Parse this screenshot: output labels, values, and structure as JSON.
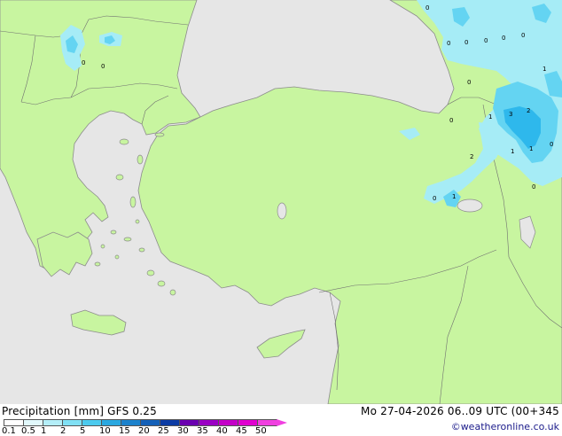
{
  "header": {
    "title": "Precipitation [mm]  GFS 0.25",
    "datetime": "Mo 27-04-2026 06..09 UTC (00+345",
    "credit": "©weatheronline.co.uk"
  },
  "colors": {
    "sea": "#e6e6e6",
    "land": "#c8f5a0",
    "coast": "#8c8c8c",
    "border": "#707070",
    "light_precip": "#a6ecf6",
    "mid_precip": "#64d4f2",
    "heavy_precip": "#2eb8ec"
  },
  "legend": {
    "ticks": [
      "0.1",
      "0.5",
      "1",
      "2",
      "5",
      "10",
      "15",
      "20",
      "25",
      "30",
      "35",
      "40",
      "45",
      "50"
    ],
    "colors": [
      "#ffffff",
      "#e2f9fc",
      "#b4eef8",
      "#80e0f4",
      "#4ccaee",
      "#2aa8e0",
      "#1c82cc",
      "#1460b8",
      "#0c3ca4",
      "#6a00b0",
      "#9a00c4",
      "#c400c8",
      "#e000d0",
      "#f040e0"
    ]
  },
  "precip_values": [
    "0",
    "0",
    "0",
    "0",
    "0",
    "0",
    "0",
    "0",
    "1",
    "0",
    "1",
    "3",
    "2",
    "1",
    "1",
    "0",
    "0",
    "2",
    "0",
    "0",
    "1"
  ]
}
